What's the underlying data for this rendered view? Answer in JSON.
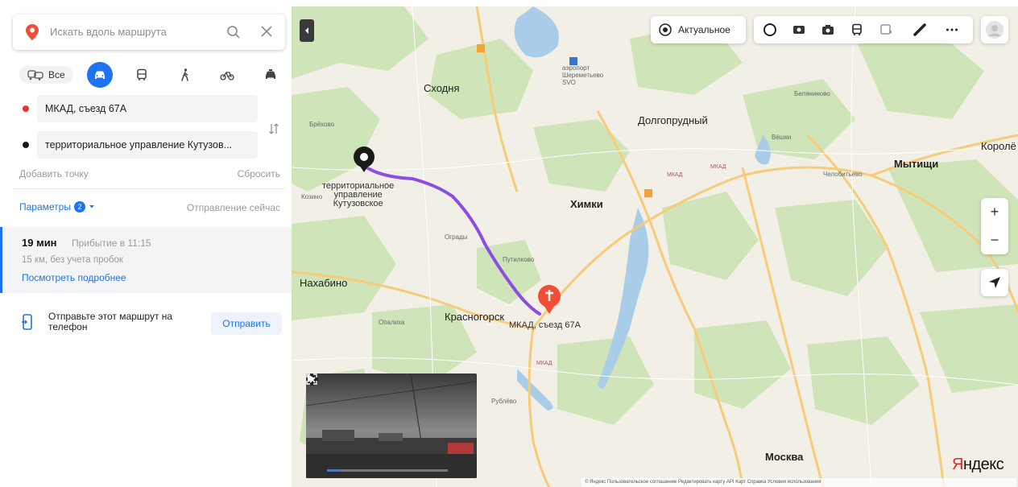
{
  "search": {
    "placeholder": "Искать вдоль маршрута"
  },
  "modes": {
    "all_label": "Все"
  },
  "route_points": {
    "from": "МКАД, съезд 67А",
    "to": "территориальное управление Кутузов..."
  },
  "actions": {
    "add_point": "Добавить точку",
    "reset": "Сбросить"
  },
  "params": {
    "label": "Параметры",
    "count": "2",
    "departure": "Отправление сейчас"
  },
  "route": {
    "duration": "19 мин",
    "arrival": "Прибытие в 11:15",
    "distance": "15 км, без учета пробок",
    "details_link": "Посмотреть подробнее"
  },
  "send": {
    "text": "Отправьте этот маршрут на телефон",
    "button": "Отправить"
  },
  "map": {
    "actual_label": "Актуальное",
    "zoom_in": "+",
    "zoom_out": "−",
    "labels": {
      "skhodnya": "Сходня",
      "airport": "аэропорт\nШереметьево\nSVO",
      "belyanino": "Беляниново",
      "brekhovo": "Брёхово",
      "dolgoprudny": "Долгопрудный",
      "vinki": "Вёшки",
      "korolyov": "Королё",
      "mytishchi": "Мытищи",
      "chelobityevo": "Челобитьево",
      "khimki": "Химки",
      "dest_marker": "территориальное\nуправление\nКутузовское",
      "kozino": "Козино",
      "ograd": "Ограды",
      "putilkovo": "Путилково",
      "nakhabino": "Нахабино",
      "krasnogorsk": "Красногорск",
      "opalikha": "Опалиха",
      "start_marker": "МКАД, съезд 67А",
      "rublevo": "Рублёво",
      "moskva": "Москва",
      "mkad1": "МКАД",
      "mkad2": "МКАД",
      "mkad3": "МКАД"
    },
    "logo": "Яндекс",
    "footer": "© Яндекс   Пользовательское соглашение   Редактировать карту   API Карт   Справка   Условия использования"
  },
  "video": {
    "progress": 0.12
  },
  "colors": {
    "accent": "#1e73f0",
    "route": "#8a4fe0",
    "start_pin": "#f04e37",
    "end_pin": "#1a1a1a",
    "map_bg": "#f2efe6",
    "forest": "#cfe4b8",
    "water": "#a9cde8",
    "road": "#f6cc7a"
  },
  "icons": {
    "search": "search-icon",
    "close": "close-icon",
    "swap": "swap-icon",
    "phone": "phone-icon",
    "locate": "locate-icon"
  }
}
